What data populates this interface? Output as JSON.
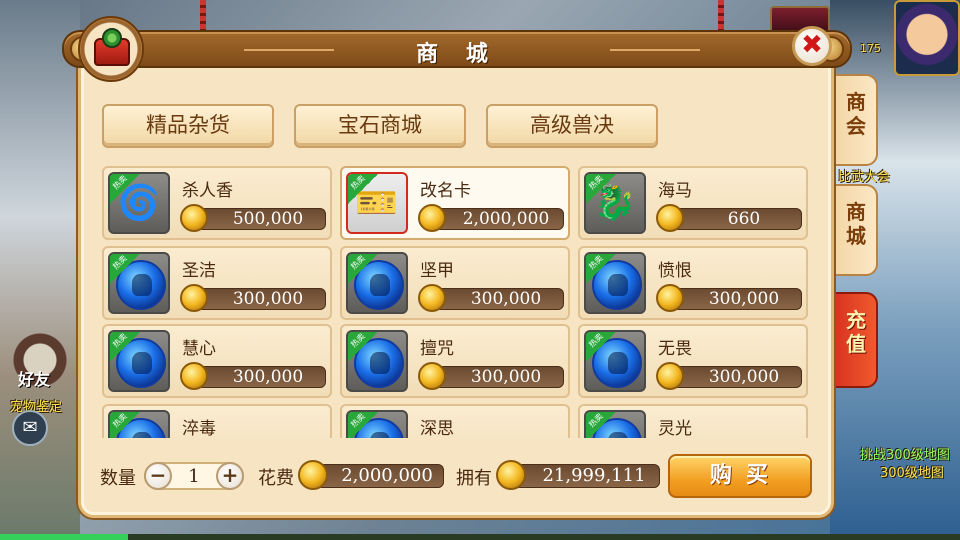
{
  "title": "商 城",
  "categories": [
    "精品杂货",
    "宝石商城",
    "高级兽决"
  ],
  "side_tabs": [
    {
      "label": "商\n会",
      "active": false
    },
    {
      "label": "商\n城",
      "active": false
    },
    {
      "label": "充\n值",
      "active": true
    }
  ],
  "hot_label": "热卖",
  "items": [
    {
      "name": "杀人香",
      "price": "500,000",
      "icon": "incense-icon",
      "hot": true
    },
    {
      "name": "改名卡",
      "price": "2,000,000",
      "icon": "rename-card-icon",
      "hot": true,
      "selected": true
    },
    {
      "name": "海马",
      "price": "660",
      "icon": "seahorse-icon",
      "hot": true
    },
    {
      "name": "圣洁",
      "price": "300,000",
      "icon": "skill-orb-icon",
      "hot": true
    },
    {
      "name": "坚甲",
      "price": "300,000",
      "icon": "skill-orb-icon",
      "hot": true
    },
    {
      "name": "愤恨",
      "price": "300,000",
      "icon": "skill-orb-icon",
      "hot": true
    },
    {
      "name": "慧心",
      "price": "300,000",
      "icon": "skill-orb-icon",
      "hot": true
    },
    {
      "name": "擅咒",
      "price": "300,000",
      "icon": "skill-orb-icon",
      "hot": true
    },
    {
      "name": "无畏",
      "price": "300,000",
      "icon": "skill-orb-icon",
      "hot": true
    },
    {
      "name": "淬毒",
      "price": "",
      "icon": "skill-orb-icon",
      "hot": true
    },
    {
      "name": "深思",
      "price": "",
      "icon": "skill-orb-icon",
      "hot": true
    },
    {
      "name": "灵光",
      "price": "",
      "icon": "skill-orb-icon",
      "hot": true
    }
  ],
  "bottom": {
    "qty_label": "数量",
    "qty_value": "1",
    "minus": "−",
    "plus": "+",
    "cost_label": "花费",
    "cost_value": "2,000,000",
    "owned_label": "拥有",
    "owned_value": "21,999,111",
    "buy_label": "购买"
  },
  "background": {
    "friend_label": "好友",
    "chat_icon": "chat-icon",
    "scene_texts": [
      "挑战300级地图",
      "300级地图",
      "比武大会",
      "宠物鉴定"
    ],
    "level_readout": "175"
  },
  "colors": {
    "panel_bg": "#f6e4c2",
    "title_bar": "#8b531d",
    "price_bar": "#7a5a3c",
    "active_tab": "#e24424",
    "buy_button": "#f2a024",
    "hot_tag": "#29a83a"
  }
}
